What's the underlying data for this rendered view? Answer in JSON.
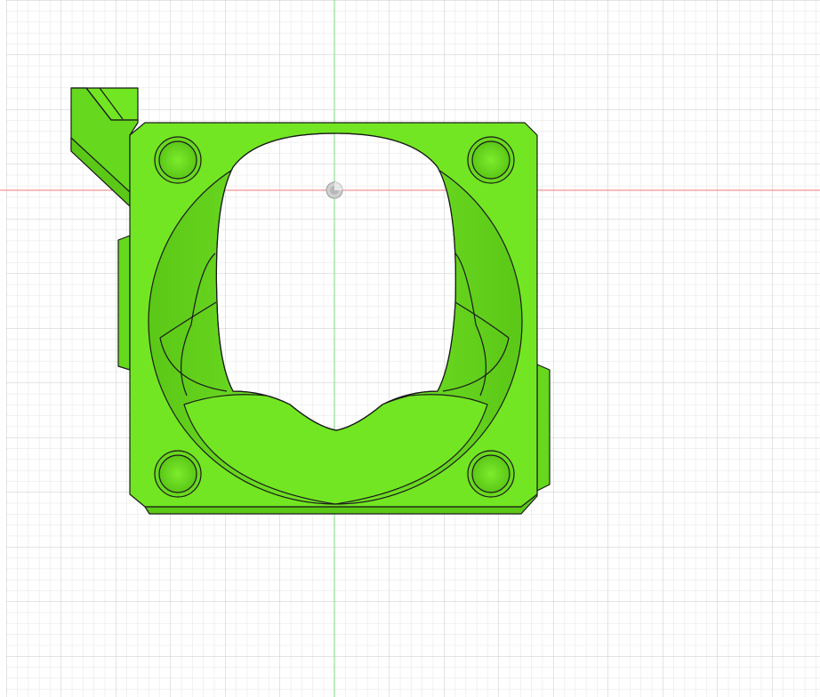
{
  "app": {
    "view": "cad-viewport",
    "projection": "top"
  },
  "grid": {
    "visible": true,
    "minor_color": "#e3e3e3",
    "major_color": "#c9c9c9"
  },
  "axes": {
    "x_axis_color": "#f07a7a",
    "y_axis_color": "#7dd87d"
  },
  "model": {
    "name": "fan-duct-part",
    "body_color": "#72e622",
    "body_shade": "#5bc717",
    "edge_color": "#1a1a1a",
    "screw_hole_count": 4,
    "selected": false
  },
  "origin_marker": {
    "icon": "origin-point-icon",
    "color": "#b8b8b8"
  }
}
